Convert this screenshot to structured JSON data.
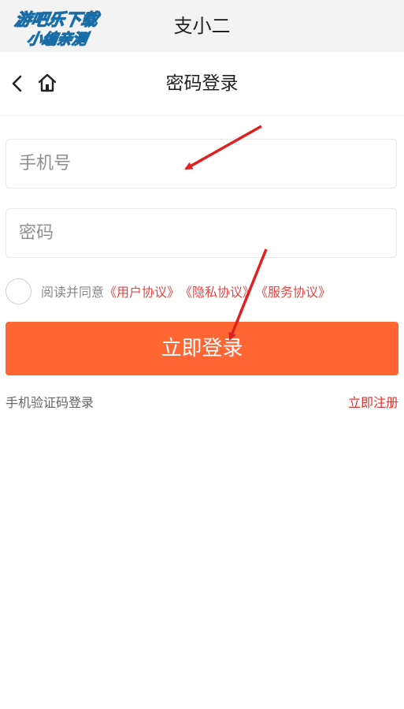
{
  "appbar": {
    "title": "支小二",
    "watermark_line1": "游吧乐下载",
    "watermark_line2": "小编亲测"
  },
  "navbar": {
    "title": "密码登录",
    "back_icon": "chevron-left-icon",
    "home_icon": "home-icon"
  },
  "form": {
    "phone_placeholder": "手机号",
    "password_placeholder": "密码"
  },
  "agreement": {
    "prefix": "阅读并同意",
    "links": [
      "《用户协议》",
      "《隐私协议》",
      "《服务协议》"
    ],
    "checked": false
  },
  "login_button": "立即登录",
  "footer": {
    "sms_login": "手机验证码登录",
    "register": "立即注册"
  },
  "colors": {
    "accent": "#ff6633",
    "link": "#e84545",
    "annotation_arrow": "#e02020"
  }
}
